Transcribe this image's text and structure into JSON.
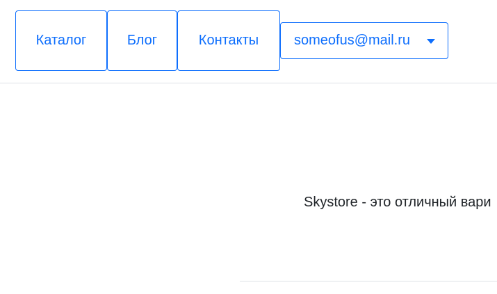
{
  "nav": {
    "items": [
      {
        "label": "Каталог"
      },
      {
        "label": "Блог"
      },
      {
        "label": "Контакты"
      }
    ],
    "user_menu": {
      "label": "someofus@mail.ru",
      "icon": "caret-down-icon"
    }
  },
  "main": {
    "intro_text": "Skystore - это отличный вари"
  },
  "colors": {
    "accent": "#0d6efd",
    "border": "#dee2e6",
    "text": "#212529"
  }
}
